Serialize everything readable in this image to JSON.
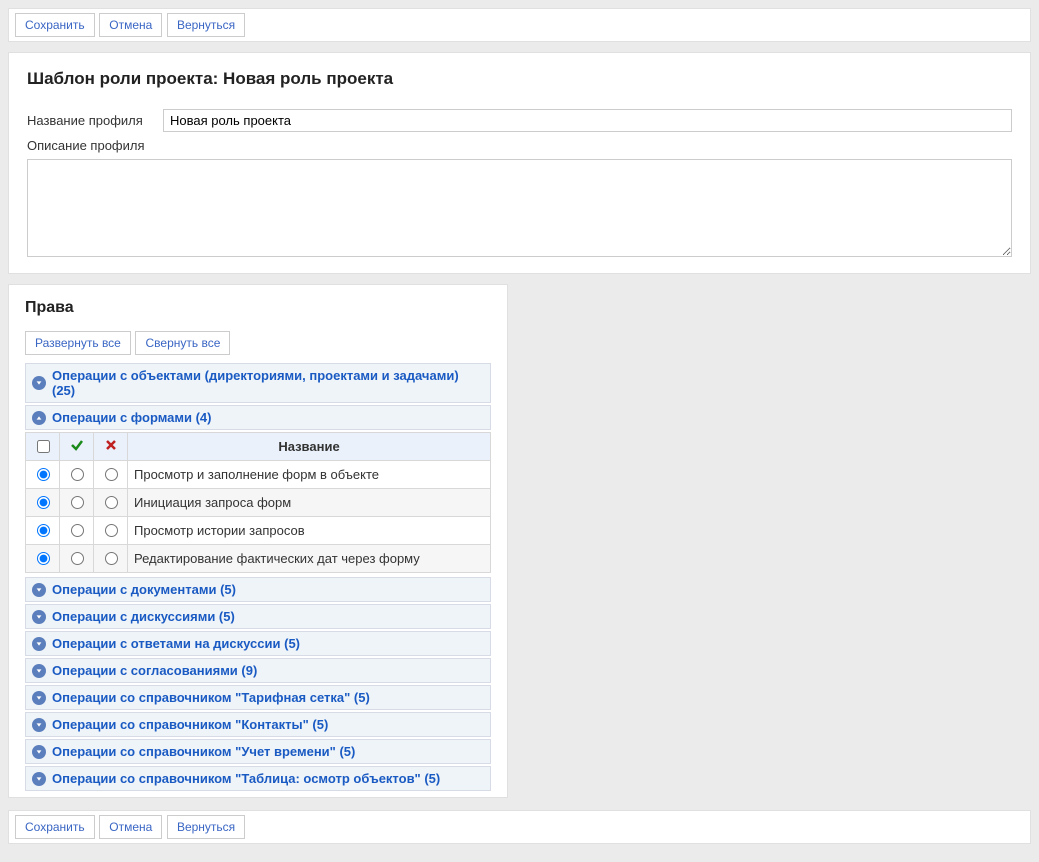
{
  "toolbar": {
    "save": "Сохранить",
    "cancel": "Отмена",
    "back": "Вернуться"
  },
  "page_title": "Шаблон роли проекта: Новая роль проекта",
  "fields": {
    "profile_name_label": "Название профиля",
    "profile_name_value": "Новая роль проекта",
    "profile_desc_label": "Описание профиля",
    "profile_desc_value": ""
  },
  "rights": {
    "title": "Права",
    "expand_all": "Развернуть все",
    "collapse_all": "Свернуть все",
    "col_name": "Название",
    "groups": [
      {
        "label": "Операции с объектами (директориями, проектами и задачами) (25)"
      },
      {
        "label": "Операции с формами (4)",
        "rows": [
          "Просмотр и заполнение форм в объекте",
          "Инициация запроса форм",
          "Просмотр истории запросов",
          "Редактирование фактических дат через форму"
        ]
      },
      {
        "label": "Операции с документами (5)"
      },
      {
        "label": "Операции с дискуссиями (5)"
      },
      {
        "label": "Операции с ответами на дискуссии (5)"
      },
      {
        "label": "Операции с согласованиями (9)"
      },
      {
        "label": "Операции со справочником \"Тарифная сетка\" (5)"
      },
      {
        "label": "Операции со справочником \"Контакты\" (5)"
      },
      {
        "label": "Операции со справочником \"Учет времени\" (5)"
      },
      {
        "label": "Операции со справочником \"Таблица: осмотр объектов\" (5)"
      }
    ]
  }
}
